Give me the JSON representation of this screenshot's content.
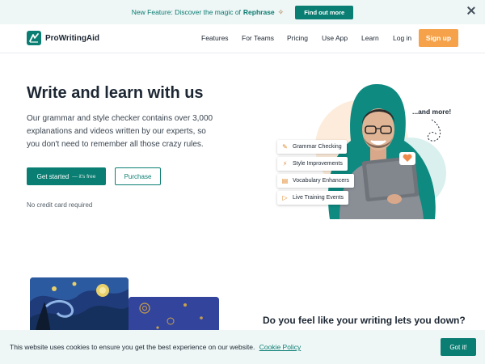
{
  "announcement": {
    "text": "New Feature: Discover the magic of",
    "highlight": "Rephrase",
    "cta_label": "Find out more"
  },
  "nav": {
    "brand": "ProWritingAid",
    "items": [
      "Features",
      "For Teams",
      "Pricing",
      "Use App",
      "Learn",
      "Log in"
    ],
    "signup_label": "Sign up"
  },
  "hero": {
    "title": "Write and learn with us",
    "description": "Our grammar and style checker contains over 3,000 explanations and videos written by our experts, so you don't need to remember all those crazy rules.",
    "primary_label": "Get started",
    "primary_suffix": "— it's free",
    "secondary_label": "Purchase",
    "note": "No credit card required",
    "features": [
      "Grammar Checking",
      "Style Improvements",
      "Vocabulary Enhancers",
      "Live Training Events"
    ],
    "more_label": "...and more!"
  },
  "section2": {
    "title": "Do you feel like your writing lets you down?"
  },
  "cookie": {
    "text": "This website uses cookies to ensure you get the best experience on our website.",
    "link_label": "Cookie Policy",
    "button_label": "Got it!"
  },
  "colors": {
    "brand": "#0b7e73",
    "accent": "#f5a24b"
  }
}
